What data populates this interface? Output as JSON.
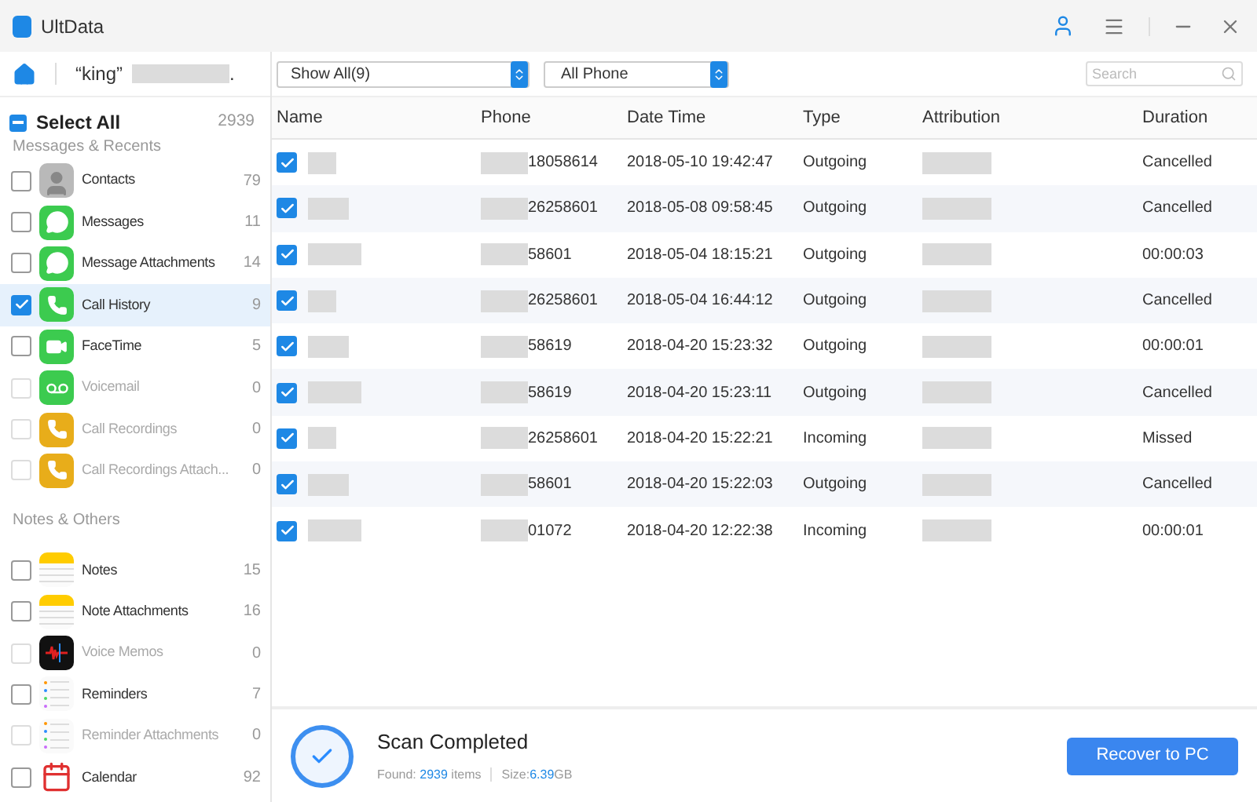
{
  "window": {
    "title": "UltData"
  },
  "toolbar": {
    "device_name": "“king”",
    "device_suffix": ".",
    "filter": "Show All(9)",
    "source": "All Phone",
    "search": {
      "placeholder": "Search"
    }
  },
  "sidebar": {
    "select_all": {
      "label": "Select All",
      "count": "2939",
      "indeterminate": true
    },
    "sections": [
      {
        "title": "Messages & Recents",
        "items": [
          {
            "kind": "contacts",
            "label": "Contacts",
            "count": "79",
            "checked": false,
            "selected": false,
            "disabled": false
          },
          {
            "kind": "messages",
            "label": "Messages",
            "count": "11",
            "checked": false,
            "selected": false,
            "disabled": false
          },
          {
            "kind": "messages",
            "label": "Message Attachments",
            "count": "14",
            "checked": false,
            "selected": false,
            "disabled": false
          },
          {
            "kind": "phone",
            "label": "Call History",
            "count": "9",
            "checked": true,
            "selected": true,
            "disabled": false
          },
          {
            "kind": "facetime",
            "label": "FaceTime",
            "count": "5",
            "checked": false,
            "selected": false,
            "disabled": false
          },
          {
            "kind": "voicemail",
            "label": "Voicemail",
            "count": "0",
            "checked": false,
            "selected": false,
            "disabled": true
          },
          {
            "kind": "recording",
            "label": "Call Recordings",
            "count": "0",
            "checked": false,
            "selected": false,
            "disabled": true
          },
          {
            "kind": "recording",
            "label": "Call Recordings Attach...",
            "count": "0",
            "checked": false,
            "selected": false,
            "disabled": true
          }
        ]
      },
      {
        "title": "Notes & Others",
        "items": [
          {
            "kind": "notes",
            "label": "Notes",
            "count": "15",
            "checked": false,
            "selected": false,
            "disabled": false
          },
          {
            "kind": "notes",
            "label": "Note Attachments",
            "count": "16",
            "checked": false,
            "selected": false,
            "disabled": false
          },
          {
            "kind": "memo",
            "label": "Voice Memos",
            "count": "0",
            "checked": false,
            "selected": false,
            "disabled": true
          },
          {
            "kind": "reminders",
            "label": "Reminders",
            "count": "7",
            "checked": false,
            "selected": false,
            "disabled": false
          },
          {
            "kind": "reminders",
            "label": "Reminder Attachments",
            "count": "0",
            "checked": false,
            "selected": false,
            "disabled": true
          },
          {
            "kind": "calendar",
            "label": "Calendar",
            "count": "92",
            "checked": false,
            "selected": false,
            "disabled": false
          }
        ]
      }
    ]
  },
  "table": {
    "columns": [
      "Name",
      "Phone",
      "Date Time",
      "Type",
      "Attribution",
      "Duration"
    ],
    "rows": [
      {
        "checked": true,
        "phone": "18058614",
        "date_time": "2018-05-10 19:42:47",
        "type": "Outgoing",
        "duration": "Cancelled"
      },
      {
        "checked": true,
        "phone": "26258601",
        "date_time": "2018-05-08 09:58:45",
        "type": "Outgoing",
        "duration": "Cancelled"
      },
      {
        "checked": true,
        "phone": "58601",
        "date_time": "2018-05-04 18:15:21",
        "type": "Outgoing",
        "duration": "00:00:03"
      },
      {
        "checked": true,
        "phone": "26258601",
        "date_time": "2018-05-04 16:44:12",
        "type": "Outgoing",
        "duration": "Cancelled"
      },
      {
        "checked": true,
        "phone": "58619",
        "date_time": "2018-04-20 15:23:32",
        "type": "Outgoing",
        "duration": "00:00:01"
      },
      {
        "checked": true,
        "phone": "58619",
        "date_time": "2018-04-20 15:23:11",
        "type": "Outgoing",
        "duration": "Cancelled"
      },
      {
        "checked": true,
        "phone": "26258601",
        "date_time": "2018-04-20 15:22:21",
        "type": "Incoming",
        "duration": "Missed"
      },
      {
        "checked": true,
        "phone": "58601",
        "date_time": "2018-04-20 15:22:03",
        "type": "Outgoing",
        "duration": "Cancelled"
      },
      {
        "checked": true,
        "phone": "01072",
        "date_time": "2018-04-20 12:22:38",
        "type": "Incoming",
        "duration": "00:00:01"
      }
    ]
  },
  "status": {
    "title": "Scan Completed",
    "found_label": "Found:",
    "found_count": "2939",
    "found_unit": "items",
    "size_label": "Size:",
    "size_value": "6.39",
    "size_unit": "GB",
    "button": "Recover to PC"
  }
}
